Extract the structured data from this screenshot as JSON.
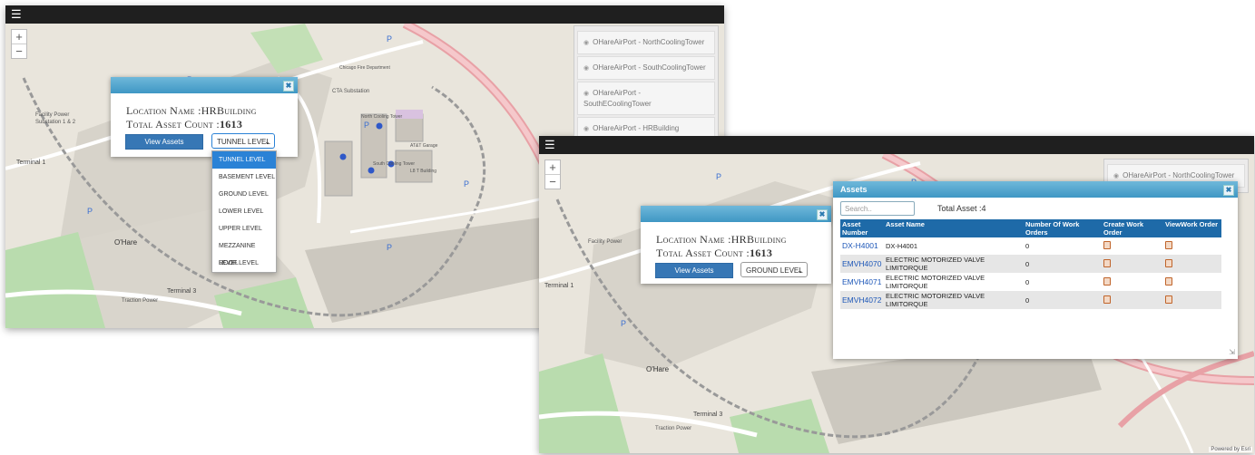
{
  "left_screen": {
    "zoom": {
      "plus": "+",
      "minus": "−"
    },
    "layers": [
      "OHareAirPort - NorthCoolingTower",
      "OHareAirPort - SouthCoolingTower",
      "OHareAirPort - SouthECoolingTower",
      "OHareAirPort - HRBuilding"
    ],
    "popup": {
      "location_label": "Location Name :",
      "location_value": "HRBuilding",
      "count_label": "Total Asset Count :",
      "count_value": "1613",
      "view_button": "View Assets",
      "level_selected": "TUNNEL LEVEL",
      "level_options": [
        "TUNNEL LEVEL",
        "BASEMENT LEVEL",
        "GROUND LEVEL",
        "LOWER LEVEL",
        "UPPER LEVEL",
        "MEZZANINE LEVEL",
        "ROOF LEVEL"
      ]
    },
    "map_labels": {
      "o_hare": "O'Hare",
      "terminal1": "Terminal 1",
      "terminal3": "Terminal 3",
      "facility_power": "Facility Power",
      "substation": "Substation 1 & 2",
      "cta": "CTA Substation",
      "north_cooling": "North Cooling Tower",
      "south_cooling": "South Cooling Tower",
      "att_garage": "AT&T Garage",
      "l8": "L8 T Building",
      "traction": "Traction Power",
      "fire": "Chicago Fire Department"
    }
  },
  "right_screen": {
    "zoom": {
      "plus": "+",
      "minus": "−"
    },
    "layers": [
      "OHareAirPort - NorthCoolingTower"
    ],
    "popup": {
      "location_label": "Location Name :",
      "location_value": "HRBuilding",
      "count_label": "Total Asset Count :",
      "count_value": "1613",
      "view_button": "View Assets",
      "level_selected": "GROUND LEVEL"
    },
    "assets": {
      "title": "Assets",
      "search_placeholder": "Search..",
      "total_label": "Total Asset :4",
      "columns": [
        "Asset Number",
        "Asset Name",
        "Number Of Work Orders",
        "Create Work Order",
        "ViewWork Order"
      ],
      "rows": [
        {
          "number": "DX-H4001",
          "name": "DX-H4001",
          "work_orders": "0"
        },
        {
          "number": "EMVH4070",
          "name": "ELECTRIC MOTORIZED VALVE LIMITORQUE",
          "work_orders": "0"
        },
        {
          "number": "EMVH4071",
          "name": "ELECTRIC MOTORIZED VALVE LIMITORQUE",
          "work_orders": "0"
        },
        {
          "number": "EMVH4072",
          "name": "ELECTRIC MOTORIZED VALVE LIMITORQUE",
          "work_orders": "0"
        }
      ]
    },
    "attribution": "Powered by Esri",
    "map_labels": {
      "o_hare": "O'Hare",
      "terminal1": "Terminal 1",
      "terminal3": "Terminal 3",
      "facility_power": "Facility Power",
      "traction": "Traction Power"
    }
  },
  "colors": {
    "header_blue": "#3f97c4",
    "button_blue": "#3777b5",
    "table_head": "#1e6aa8",
    "link": "#1d57b8",
    "select_highlight": "#2a82d6"
  },
  "icons": {
    "menu": "hamburger-icon",
    "layer": "eye-icon",
    "close": "close-icon",
    "chevron": "chevron-down-icon",
    "work_order": "document-icon"
  }
}
